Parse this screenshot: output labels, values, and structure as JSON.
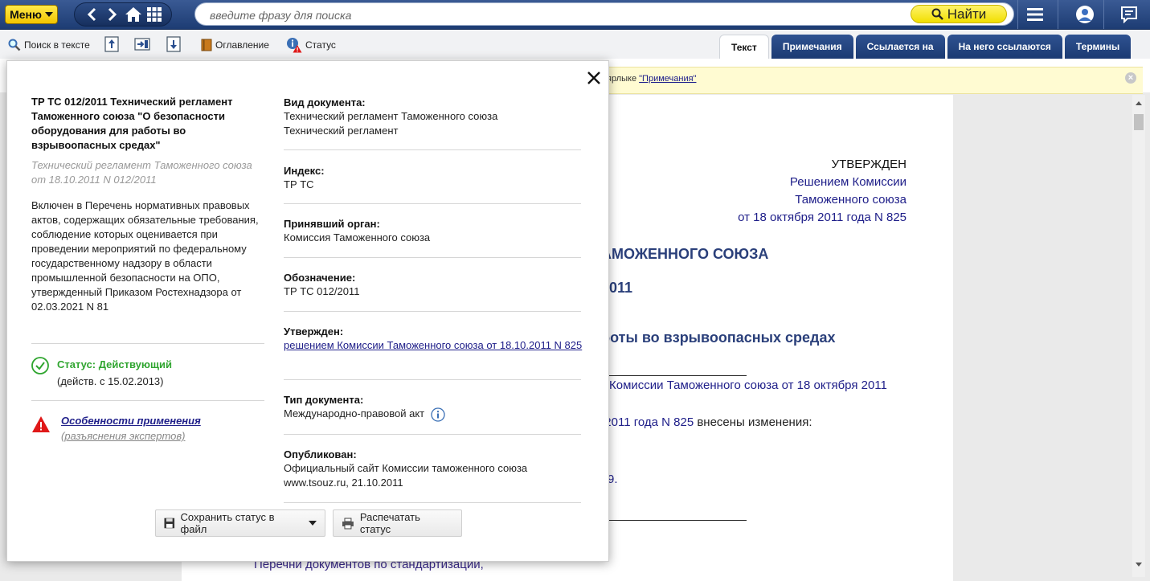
{
  "topbar": {
    "menu_label": "Меню",
    "search_placeholder": "введите фразу для поиска",
    "find_label": "Найти"
  },
  "toolbar": {
    "search_in_text": "Поиск в тексте",
    "contents": "Оглавление",
    "status": "Статус"
  },
  "tabs": [
    {
      "label": "Текст",
      "active": true
    },
    {
      "label": "Примечания",
      "active": false
    },
    {
      "label": "Ссылается на",
      "active": false
    },
    {
      "label": "На него ссылаются",
      "active": false
    },
    {
      "label": "Термины",
      "active": false
    }
  ],
  "notice": {
    "text_prefix": "ярлыке ",
    "link": "\"Примечания\""
  },
  "document": {
    "approved": "УТВЕРЖДЕН",
    "approved_by_1": "Решением Комиссии",
    "approved_by_2": "Таможенного союза",
    "approved_by_3": "от 18 октября 2011 года N 825",
    "heading_1": "АМОЖЕННОГО СОЮЗА",
    "heading_2": "2011",
    "heading_3": "боты во взрывоопасных средах",
    "line_1": "Комиссии Таможенного союза от 18 октября 2011",
    "line_2_blue": "я 2011 года N 825",
    "line_2_tail": " внесены изменения:",
    "line_3": "9.",
    "line_bottom": "Перечни документов по стандартизации,"
  },
  "popup": {
    "title": "ТР ТС 012/2011 Технический регламент Таможенного союза \"О безопасности оборудования для работы во взрывоопасных средах\"",
    "subtitle": "Технический регламент Таможенного союза от 18.10.2011 N 012/2011",
    "inclusion": "Включен в Перечень нормативных правовых актов, содержащих обязательные требования, соблюдение которых оценивается при проведении мероприятий по федеральному государственному надзору в области промышленной безопасности на ОПО, утвержденный Приказом Ростехнадзора от 02.03.2021 N 81",
    "status_label": "Статус: Действующий",
    "status_date": "(действ. с 15.02.2013)",
    "special_link": "Особенности применения",
    "special_sub": "(разъяснения экспертов)",
    "fields": {
      "doc_type_label": "Вид документа:",
      "doc_type_value_1": "Технический регламент Таможенного союза",
      "doc_type_value_2": "Технический регламент",
      "index_label": "Индекс:",
      "index_value": "ТР ТС",
      "body_label": "Принявший орган:",
      "body_value": "Комиссия Таможенного союза",
      "designation_label": "Обозначение:",
      "designation_value": "ТР ТС 012/2011",
      "approved_label": "Утвержден:",
      "approved_link": "решением Комиссии Таможенного союза от 18.10.2011 N 825",
      "kind_label": "Тип документа:",
      "kind_value": "Международно-правовой акт",
      "published_label": "Опубликован:",
      "published_value": "Официальный сайт Комиссии таможенного союза www.tsouz.ru, 21.10.2011"
    },
    "save_button": "Сохранить статус в файл",
    "print_button": "Распечатать статус"
  },
  "colors": {
    "topbar": "#1d3c73",
    "accent_yellow": "#f1df00",
    "status_green": "#2fa52f",
    "warning_red": "#e01818",
    "link_blue": "#20208a"
  },
  "icons": [
    "back-icon",
    "forward-icon",
    "home-icon",
    "grid-icon",
    "search-icon",
    "hamburger-icon",
    "user-icon",
    "feedback-icon",
    "magnifier-icon",
    "prev-occurrence-icon",
    "sync-icon",
    "next-occurrence-icon",
    "book-icon",
    "info-warning-icon",
    "close-icon",
    "check-circle-icon",
    "warning-triangle-icon",
    "info-icon",
    "save-icon",
    "print-icon"
  ]
}
